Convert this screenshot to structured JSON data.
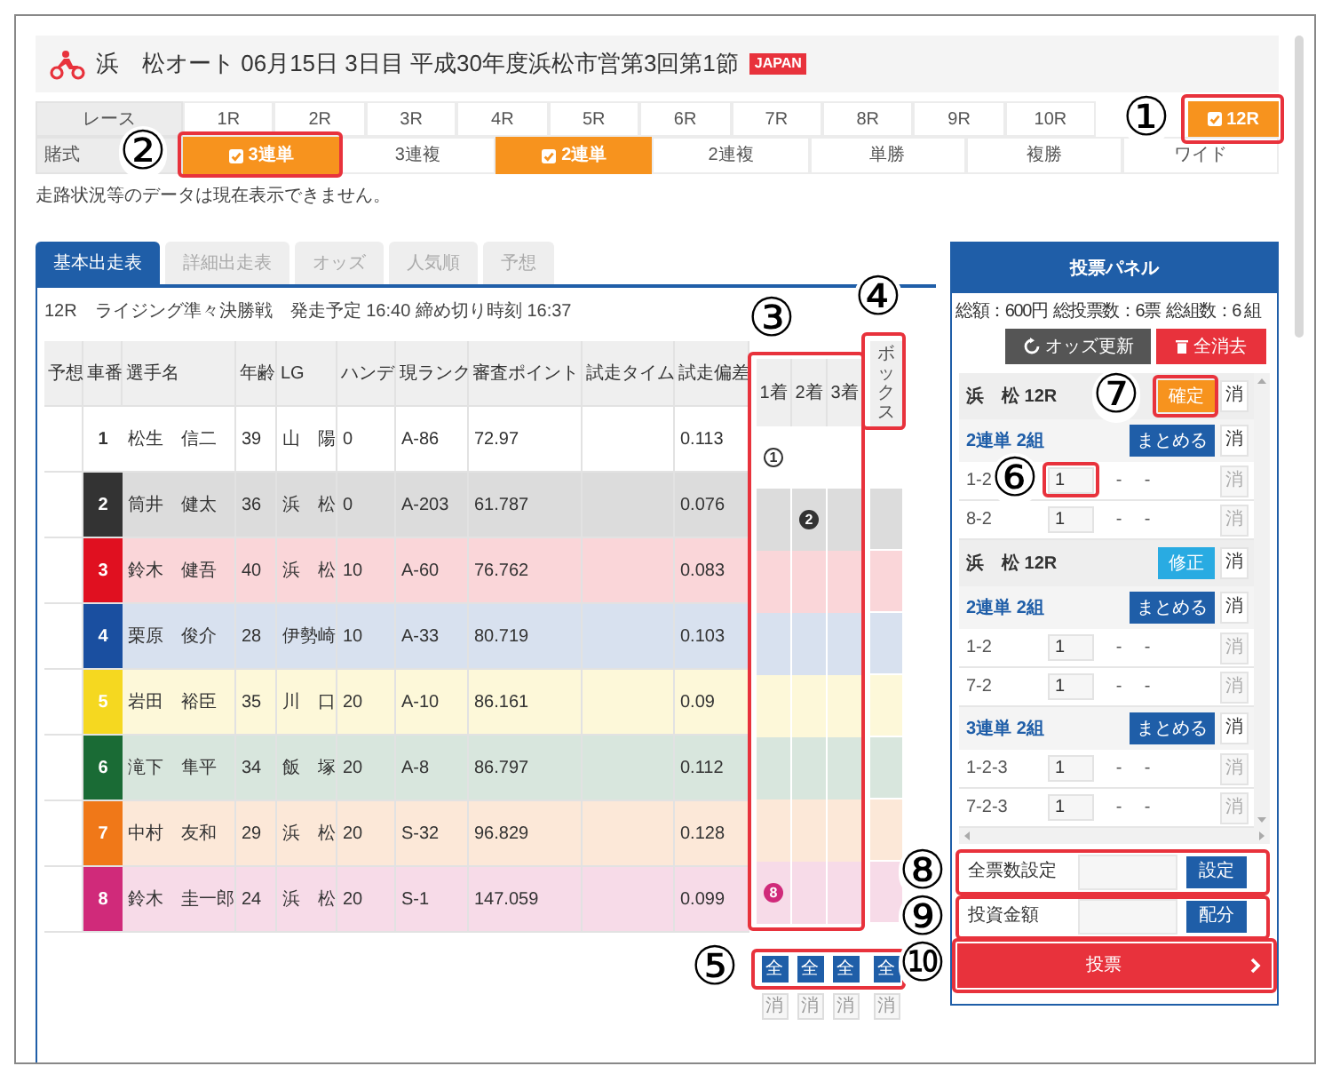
{
  "header": {
    "title": "浜　松オート 06月15日 3日目 平成30年度浜松市営第3回第1節",
    "badge": "JAPAN"
  },
  "races": {
    "label": "レース",
    "items": [
      {
        "label": "1R",
        "selected": false
      },
      {
        "label": "2R",
        "selected": false
      },
      {
        "label": "3R",
        "selected": false
      },
      {
        "label": "4R",
        "selected": false
      },
      {
        "label": "5R",
        "selected": false
      },
      {
        "label": "6R",
        "selected": false
      },
      {
        "label": "7R",
        "selected": false
      },
      {
        "label": "8R",
        "selected": false
      },
      {
        "label": "9R",
        "selected": false
      },
      {
        "label": "10R",
        "selected": false
      },
      {
        "label": "12R",
        "selected": true
      }
    ]
  },
  "bet_types": {
    "label": "賭式",
    "items": [
      {
        "label": "3連単",
        "selected": true
      },
      {
        "label": "3連複",
        "selected": false
      },
      {
        "label": "2連単",
        "selected": true
      },
      {
        "label": "2連複",
        "selected": false
      },
      {
        "label": "単勝",
        "selected": false
      },
      {
        "label": "複勝",
        "selected": false
      },
      {
        "label": "ワイド",
        "selected": false
      }
    ]
  },
  "notice": "走路状況等のデータは現在表示できません。",
  "tabs": [
    {
      "label": "基本出走表",
      "selected": true
    },
    {
      "label": "詳細出走表",
      "selected": false
    },
    {
      "label": "オッズ",
      "selected": false
    },
    {
      "label": "人気順",
      "selected": false
    },
    {
      "label": "予想",
      "selected": false
    }
  ],
  "race_info": "12R　ライジング準々決勝戦　発走予定 16:40 締め切り時刻 16:37",
  "entries": {
    "columns": [
      "予想",
      "車番",
      "選手名",
      "年齢",
      "LG",
      "ハンデ",
      "現ランク",
      "審査ポイント",
      "試走タイム",
      "試走偏差"
    ],
    "rows": [
      {
        "car": "1",
        "color": "#ffffff",
        "name": "松生　信二",
        "age": "39",
        "lg": "山　陽",
        "handicap": "0",
        "rank": "A-86",
        "points": "72.97",
        "deviation": "0.113"
      },
      {
        "car": "2",
        "color": "#333333",
        "name": "筒井　健太",
        "age": "36",
        "lg": "浜　松",
        "handicap": "0",
        "rank": "A-203",
        "points": "61.787",
        "deviation": "0.076"
      },
      {
        "car": "3",
        "color": "#e01020",
        "name": "鈴木　健吾",
        "age": "40",
        "lg": "浜　松",
        "handicap": "10",
        "rank": "A-60",
        "points": "76.762",
        "deviation": "0.083"
      },
      {
        "car": "4",
        "color": "#1a4fa0",
        "name": "栗原　俊介",
        "age": "28",
        "lg": "伊勢崎",
        "handicap": "10",
        "rank": "A-33",
        "points": "80.719",
        "deviation": "0.103"
      },
      {
        "car": "5",
        "color": "#f5d820",
        "name": "岩田　裕臣",
        "age": "35",
        "lg": "川　口",
        "handicap": "20",
        "rank": "A-10",
        "points": "86.161",
        "deviation": "0.09"
      },
      {
        "car": "6",
        "color": "#1a6b35",
        "name": "滝下　隼平",
        "age": "34",
        "lg": "飯　塚",
        "handicap": "20",
        "rank": "A-8",
        "points": "86.797",
        "deviation": "0.112"
      },
      {
        "car": "7",
        "color": "#f07818",
        "name": "中村　友和",
        "age": "29",
        "lg": "浜　松",
        "handicap": "20",
        "rank": "S-32",
        "points": "96.829",
        "deviation": "0.128"
      },
      {
        "car": "8",
        "color": "#d02a7a",
        "name": "鈴木　圭一郎",
        "age": "24",
        "lg": "浜　松",
        "handicap": "20",
        "rank": "S-1",
        "points": "147.059",
        "deviation": "0.099"
      }
    ]
  },
  "picks": {
    "columns": [
      "1着",
      "2着",
      "3着"
    ],
    "rows": [
      {
        "first": "1"
      },
      {
        "second": "2"
      },
      {},
      {},
      {},
      {},
      {},
      {
        "first": "8"
      }
    ],
    "all_buttons": [
      "全",
      "全",
      "全"
    ],
    "clear_buttons": [
      "消",
      "消",
      "消"
    ]
  },
  "box": {
    "header": "ボックス",
    "all_button": "全",
    "clear_button": "消"
  },
  "panel": {
    "title": "投票パネル",
    "summary": [
      "総額：600円",
      "総投票数：6票",
      "総組数：6 組"
    ],
    "refresh_button": "オッズ更新",
    "clear_all_button": "全消去",
    "groups": [
      {
        "venue": "浜　松 12R",
        "action": {
          "kind": "confirm",
          "label": "確定"
        },
        "clear": "消",
        "bets": [
          {
            "type": "2連単 2組",
            "merge": "まとめる",
            "clear": "消",
            "lines": [
              {
                "combo": "1-2",
                "amount": "1",
                "col_3": "-",
                "col_4": "-",
                "clear": "消"
              },
              {
                "combo": "8-2",
                "amount": "1",
                "col_3": "-",
                "col_4": "-",
                "clear": "消"
              }
            ]
          }
        ]
      },
      {
        "venue": "浜　松 12R",
        "action": {
          "kind": "edit",
          "label": "修正"
        },
        "clear": "消",
        "bets": [
          {
            "type": "2連単 2組",
            "merge": "まとめる",
            "clear": "消",
            "lines": [
              {
                "combo": "1-2",
                "amount": "1",
                "col_3": "-",
                "col_4": "-",
                "clear": "消"
              },
              {
                "combo": "7-2",
                "amount": "1",
                "col_3": "-",
                "col_4": "-",
                "clear": "消"
              }
            ]
          },
          {
            "type": "3連単 2組",
            "merge": "まとめる",
            "clear": "消",
            "lines": [
              {
                "combo": "1-2-3",
                "amount": "1",
                "col_3": "-",
                "col_4": "-",
                "clear": "消"
              },
              {
                "combo": "7-2-3",
                "amount": "1",
                "col_3": "-",
                "col_4": "-",
                "clear": "消"
              }
            ]
          }
        ]
      }
    ],
    "total_tickets": {
      "label": "全票数設定",
      "button": "設定"
    },
    "investment": {
      "label": "投資金額",
      "button": "配分"
    },
    "vote_button": "投票"
  },
  "callouts": [
    "①",
    "②",
    "③",
    "④",
    "⑤",
    "⑥",
    "⑦",
    "⑧",
    "⑨",
    "⑩"
  ]
}
